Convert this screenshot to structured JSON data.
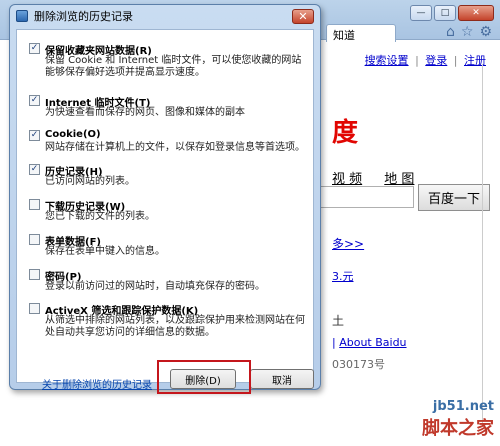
{
  "browser": {
    "tab_title": "知道",
    "toplinks": {
      "search_settings": "搜索设置",
      "login": "登录",
      "register": "注册",
      "sep": "|"
    },
    "logo_fragment": "度",
    "nav": [
      "视 频",
      "地 图"
    ],
    "search_button": "百度一下",
    "more_link": "多>>",
    "promo_link": "3.元",
    "promo_text": "土",
    "about_link": "About Baidu",
    "icp_text": "030173号",
    "watermark": {
      "site": "jb51.net",
      "brand": "脚本之家"
    }
  },
  "dialog": {
    "title": "删除浏览的历史记录",
    "close_glyph": "✕",
    "options": [
      {
        "checked": true,
        "title": "保留收藏夹网站数据(R)",
        "desc": "保留 Cookie 和 Internet 临时文件，可以使您收藏的网站能够保存偏好选项并提高显示速度。"
      },
      {
        "checked": true,
        "title": "Internet 临时文件(T)",
        "desc": "为快速查看而保存的网页、图像和媒体的副本"
      },
      {
        "checked": true,
        "title": "Cookie(O)",
        "desc": "网站存储在计算机上的文件，以保存如登录信息等首选项。"
      },
      {
        "checked": true,
        "title": "历史记录(H)",
        "desc": "已访问网站的列表。"
      },
      {
        "checked": false,
        "title": "下载历史记录(W)",
        "desc": "您已下载的文件的列表。"
      },
      {
        "checked": false,
        "title": "表单数据(F)",
        "desc": "保存在表单中键入的信息。"
      },
      {
        "checked": false,
        "title": "密码(P)",
        "desc": "登录以前访问过的网站时，自动填充保存的密码。"
      },
      {
        "checked": false,
        "title": "ActiveX 筛选和跟踪保护数据(K)",
        "desc": "从筛选中排除的网站列表，以及跟踪保护用来检测网站在何处自动共享您访问的详细信息的数据。"
      }
    ],
    "about_link": "关于删除浏览的历史记录",
    "delete_button": "删除(D)",
    "cancel_button": "取消",
    "check_glyph": "✓"
  }
}
